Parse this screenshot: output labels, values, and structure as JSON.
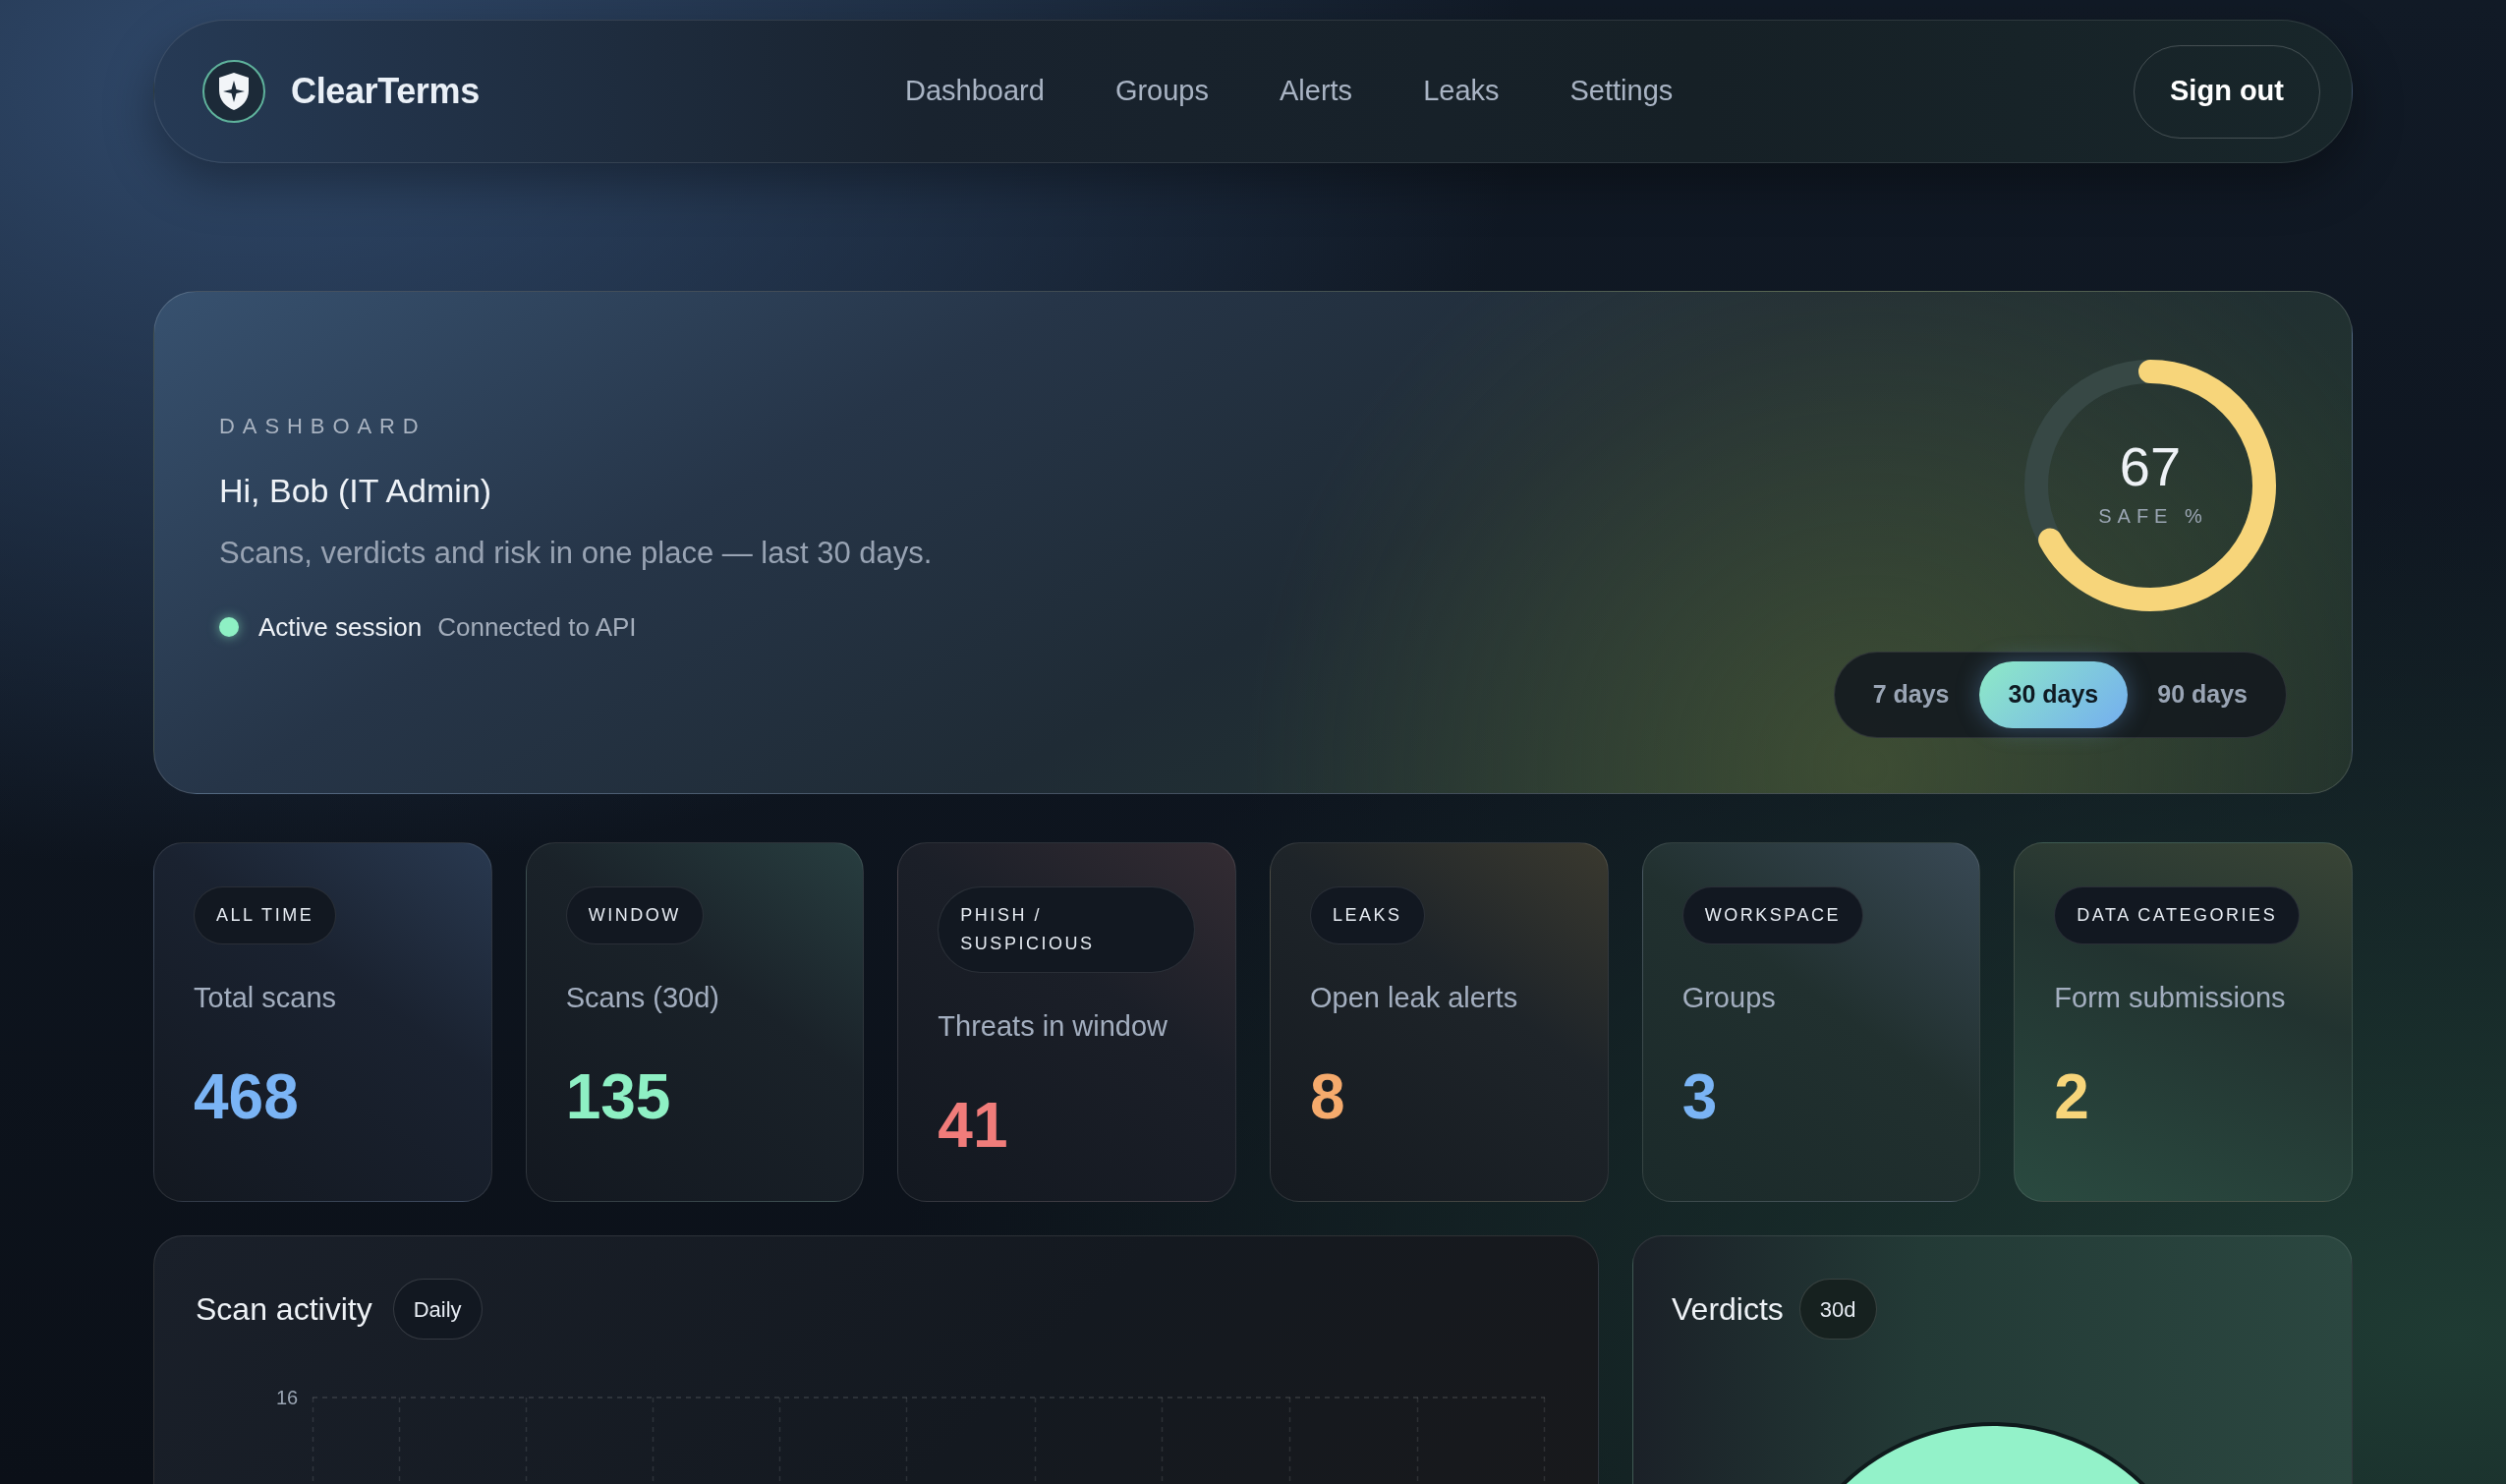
{
  "nav": {
    "brand": "ClearTerms",
    "links": [
      "Dashboard",
      "Groups",
      "Alerts",
      "Leaks",
      "Settings"
    ],
    "action": "Sign out"
  },
  "hero": {
    "eyebrow": "DASHBOARD",
    "greeting": "Hi, Bob (IT Admin)",
    "subtitle": "Scans, verdicts and risk in one place — last 30 days.",
    "session": {
      "label": "Active session",
      "detail": "Connected to API",
      "active": true
    },
    "meter": {
      "value": "67",
      "label": "SAFE %",
      "level": 0.67
    },
    "ranges": [
      {
        "label": "7 days",
        "selected": false
      },
      {
        "label": "30 days",
        "selected": true
      },
      {
        "label": "90 days",
        "selected": false
      }
    ]
  },
  "stats": [
    {
      "tag": "ALL TIME",
      "label": "Total scans",
      "value": "468",
      "color": "#7ab4f5"
    },
    {
      "tag": "WINDOW",
      "label": "Scans (30d)",
      "value": "135",
      "color": "#8ef0c4"
    },
    {
      "tag": "PHISH / SUSPICIOUS",
      "label": "Threats in window",
      "value": "41",
      "color": "#f07c7a"
    },
    {
      "tag": "LEAKS",
      "label": "Open leak alerts",
      "value": "8",
      "color": "#f5aa6c"
    },
    {
      "tag": "WORKSPACE",
      "label": "Groups",
      "value": "3",
      "color": "#7ab4f5"
    },
    {
      "tag": "DATA CATEGORIES",
      "label": "Form submissions",
      "value": "2",
      "color": "#f7d57a"
    }
  ],
  "activity": {
    "title": "Scan activity",
    "badge": "Daily",
    "y_tick": "16"
  },
  "verdicts": {
    "title": "Verdicts",
    "badge": "30d"
  }
}
